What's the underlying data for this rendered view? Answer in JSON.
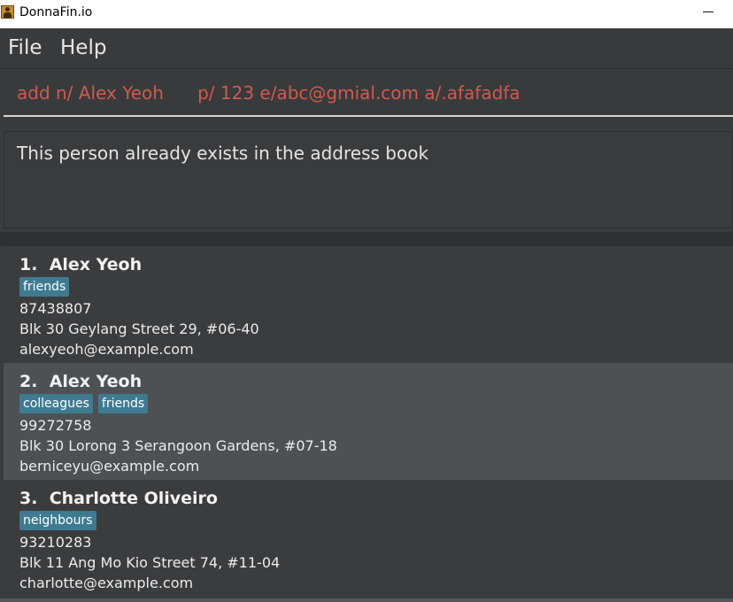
{
  "window": {
    "title": "DonnaFin.io",
    "minimize_icon": "minimize-icon"
  },
  "menu": {
    "items": [
      "File",
      "Help"
    ]
  },
  "command": {
    "value": "add n/ Alex Yeoh      p/ 123 e/abc@gmial.com a/.afafadfa"
  },
  "result": {
    "message": "This person already exists in the address book"
  },
  "colors": {
    "command_text": "#d05a4e",
    "tag_bg": "#3e7b91",
    "selected_card": "#4d5153",
    "background": "#3a3b3d"
  },
  "persons": [
    {
      "index": "1.",
      "name": "Alex Yeoh",
      "tags": [
        "friends"
      ],
      "phone": "87438807",
      "address": "Blk 30 Geylang Street 29, #06-40",
      "email": "alexyeoh@example.com"
    },
    {
      "index": "2.",
      "name": "Alex Yeoh",
      "tags": [
        "colleagues",
        "friends"
      ],
      "phone": "99272758",
      "address": "Blk 30 Lorong 3 Serangoon Gardens, #07-18",
      "email": "berniceyu@example.com"
    },
    {
      "index": "3.",
      "name": "Charlotte Oliveiro",
      "tags": [
        "neighbours"
      ],
      "phone": "93210283",
      "address": "Blk 11 Ang Mo Kio Street 74, #11-04",
      "email": "charlotte@example.com"
    }
  ]
}
